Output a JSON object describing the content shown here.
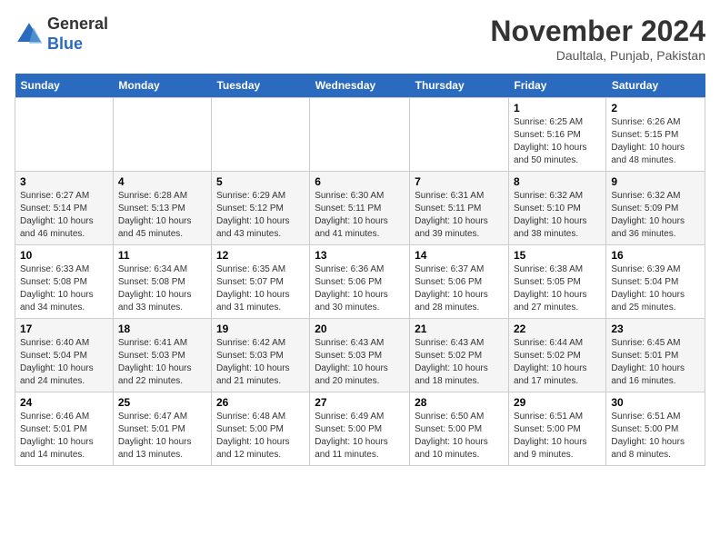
{
  "header": {
    "logo_line1": "General",
    "logo_line2": "Blue",
    "month_year": "November 2024",
    "location": "Daultala, Punjab, Pakistan"
  },
  "days_of_week": [
    "Sunday",
    "Monday",
    "Tuesday",
    "Wednesday",
    "Thursday",
    "Friday",
    "Saturday"
  ],
  "weeks": [
    [
      {
        "day": "",
        "info": ""
      },
      {
        "day": "",
        "info": ""
      },
      {
        "day": "",
        "info": ""
      },
      {
        "day": "",
        "info": ""
      },
      {
        "day": "",
        "info": ""
      },
      {
        "day": "1",
        "info": "Sunrise: 6:25 AM\nSunset: 5:16 PM\nDaylight: 10 hours and 50 minutes."
      },
      {
        "day": "2",
        "info": "Sunrise: 6:26 AM\nSunset: 5:15 PM\nDaylight: 10 hours and 48 minutes."
      }
    ],
    [
      {
        "day": "3",
        "info": "Sunrise: 6:27 AM\nSunset: 5:14 PM\nDaylight: 10 hours and 46 minutes."
      },
      {
        "day": "4",
        "info": "Sunrise: 6:28 AM\nSunset: 5:13 PM\nDaylight: 10 hours and 45 minutes."
      },
      {
        "day": "5",
        "info": "Sunrise: 6:29 AM\nSunset: 5:12 PM\nDaylight: 10 hours and 43 minutes."
      },
      {
        "day": "6",
        "info": "Sunrise: 6:30 AM\nSunset: 5:11 PM\nDaylight: 10 hours and 41 minutes."
      },
      {
        "day": "7",
        "info": "Sunrise: 6:31 AM\nSunset: 5:11 PM\nDaylight: 10 hours and 39 minutes."
      },
      {
        "day": "8",
        "info": "Sunrise: 6:32 AM\nSunset: 5:10 PM\nDaylight: 10 hours and 38 minutes."
      },
      {
        "day": "9",
        "info": "Sunrise: 6:32 AM\nSunset: 5:09 PM\nDaylight: 10 hours and 36 minutes."
      }
    ],
    [
      {
        "day": "10",
        "info": "Sunrise: 6:33 AM\nSunset: 5:08 PM\nDaylight: 10 hours and 34 minutes."
      },
      {
        "day": "11",
        "info": "Sunrise: 6:34 AM\nSunset: 5:08 PM\nDaylight: 10 hours and 33 minutes."
      },
      {
        "day": "12",
        "info": "Sunrise: 6:35 AM\nSunset: 5:07 PM\nDaylight: 10 hours and 31 minutes."
      },
      {
        "day": "13",
        "info": "Sunrise: 6:36 AM\nSunset: 5:06 PM\nDaylight: 10 hours and 30 minutes."
      },
      {
        "day": "14",
        "info": "Sunrise: 6:37 AM\nSunset: 5:06 PM\nDaylight: 10 hours and 28 minutes."
      },
      {
        "day": "15",
        "info": "Sunrise: 6:38 AM\nSunset: 5:05 PM\nDaylight: 10 hours and 27 minutes."
      },
      {
        "day": "16",
        "info": "Sunrise: 6:39 AM\nSunset: 5:04 PM\nDaylight: 10 hours and 25 minutes."
      }
    ],
    [
      {
        "day": "17",
        "info": "Sunrise: 6:40 AM\nSunset: 5:04 PM\nDaylight: 10 hours and 24 minutes."
      },
      {
        "day": "18",
        "info": "Sunrise: 6:41 AM\nSunset: 5:03 PM\nDaylight: 10 hours and 22 minutes."
      },
      {
        "day": "19",
        "info": "Sunrise: 6:42 AM\nSunset: 5:03 PM\nDaylight: 10 hours and 21 minutes."
      },
      {
        "day": "20",
        "info": "Sunrise: 6:43 AM\nSunset: 5:03 PM\nDaylight: 10 hours and 20 minutes."
      },
      {
        "day": "21",
        "info": "Sunrise: 6:43 AM\nSunset: 5:02 PM\nDaylight: 10 hours and 18 minutes."
      },
      {
        "day": "22",
        "info": "Sunrise: 6:44 AM\nSunset: 5:02 PM\nDaylight: 10 hours and 17 minutes."
      },
      {
        "day": "23",
        "info": "Sunrise: 6:45 AM\nSunset: 5:01 PM\nDaylight: 10 hours and 16 minutes."
      }
    ],
    [
      {
        "day": "24",
        "info": "Sunrise: 6:46 AM\nSunset: 5:01 PM\nDaylight: 10 hours and 14 minutes."
      },
      {
        "day": "25",
        "info": "Sunrise: 6:47 AM\nSunset: 5:01 PM\nDaylight: 10 hours and 13 minutes."
      },
      {
        "day": "26",
        "info": "Sunrise: 6:48 AM\nSunset: 5:00 PM\nDaylight: 10 hours and 12 minutes."
      },
      {
        "day": "27",
        "info": "Sunrise: 6:49 AM\nSunset: 5:00 PM\nDaylight: 10 hours and 11 minutes."
      },
      {
        "day": "28",
        "info": "Sunrise: 6:50 AM\nSunset: 5:00 PM\nDaylight: 10 hours and 10 minutes."
      },
      {
        "day": "29",
        "info": "Sunrise: 6:51 AM\nSunset: 5:00 PM\nDaylight: 10 hours and 9 minutes."
      },
      {
        "day": "30",
        "info": "Sunrise: 6:51 AM\nSunset: 5:00 PM\nDaylight: 10 hours and 8 minutes."
      }
    ]
  ]
}
